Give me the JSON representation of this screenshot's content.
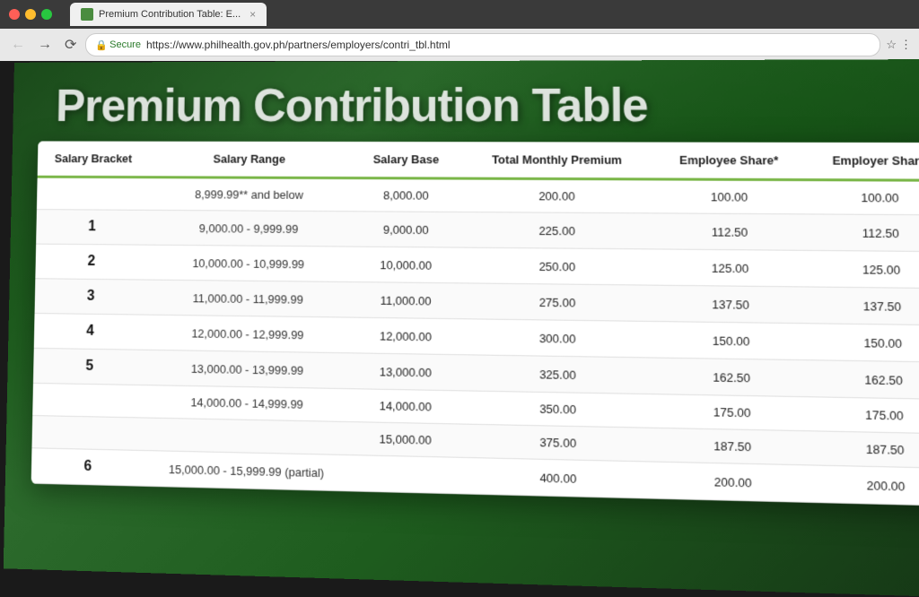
{
  "browser": {
    "tab_title": "Premium Contribution Table: E...",
    "url": "https://www.philhealth.gov.ph/partners/employers/contri_tbl.html",
    "secure_label": "Secure",
    "favicon_color": "#4a8c3f"
  },
  "page": {
    "title": "Premium Contribution Table",
    "table": {
      "headers": {
        "salary_bracket": "Salary Bracket",
        "salary_range": "Salary Range",
        "salary_base": "Salary Base",
        "total_monthly_premium": "Total Monthly Premium",
        "employee_share": "Employee Share*",
        "employer_share": "Employer Share"
      },
      "rows": [
        {
          "bracket": "",
          "range": "8,999.99** and below",
          "salary_base": "8,000.00",
          "total_monthly": "200.00",
          "employee_share": "100.00",
          "employer_share": "100.00"
        },
        {
          "bracket": "1",
          "range": "9,000.00 - 9,999.99",
          "salary_base": "9,000.00",
          "total_monthly": "225.00",
          "employee_share": "112.50",
          "employer_share": "112.50"
        },
        {
          "bracket": "2",
          "range": "10,000.00 - 10,999.99",
          "salary_base": "10,000.00",
          "total_monthly": "250.00",
          "employee_share": "125.00",
          "employer_share": "125.00"
        },
        {
          "bracket": "3",
          "range": "11,000.00 - 11,999.99",
          "salary_base": "11,000.00",
          "total_monthly": "275.00",
          "employee_share": "137.50",
          "employer_share": "137.50"
        },
        {
          "bracket": "4",
          "range": "12,000.00 - 12,999.99",
          "salary_base": "12,000.00",
          "total_monthly": "300.00",
          "employee_share": "150.00",
          "employer_share": "150.00"
        },
        {
          "bracket": "5",
          "range": "13,000.00 - 13,999.99",
          "salary_base": "13,000.00",
          "total_monthly": "325.00",
          "employee_share": "162.50",
          "employer_share": "162.50"
        },
        {
          "bracket": "",
          "range": "14,000.00 - 14,999.99",
          "salary_base": "14,000.00",
          "total_monthly": "350.00",
          "employee_share": "175.00",
          "employer_share": "175.00"
        },
        {
          "bracket": "",
          "range": "",
          "salary_base": "15,000.00",
          "total_monthly": "375.00",
          "employee_share": "187.50",
          "employer_share": "187.50"
        },
        {
          "bracket": "6",
          "range": "15,000.00 - 15,999.99 (partial)",
          "salary_base": "",
          "total_monthly": "400.00",
          "employee_share": "200.00",
          "employer_share": "200.00"
        }
      ]
    }
  }
}
